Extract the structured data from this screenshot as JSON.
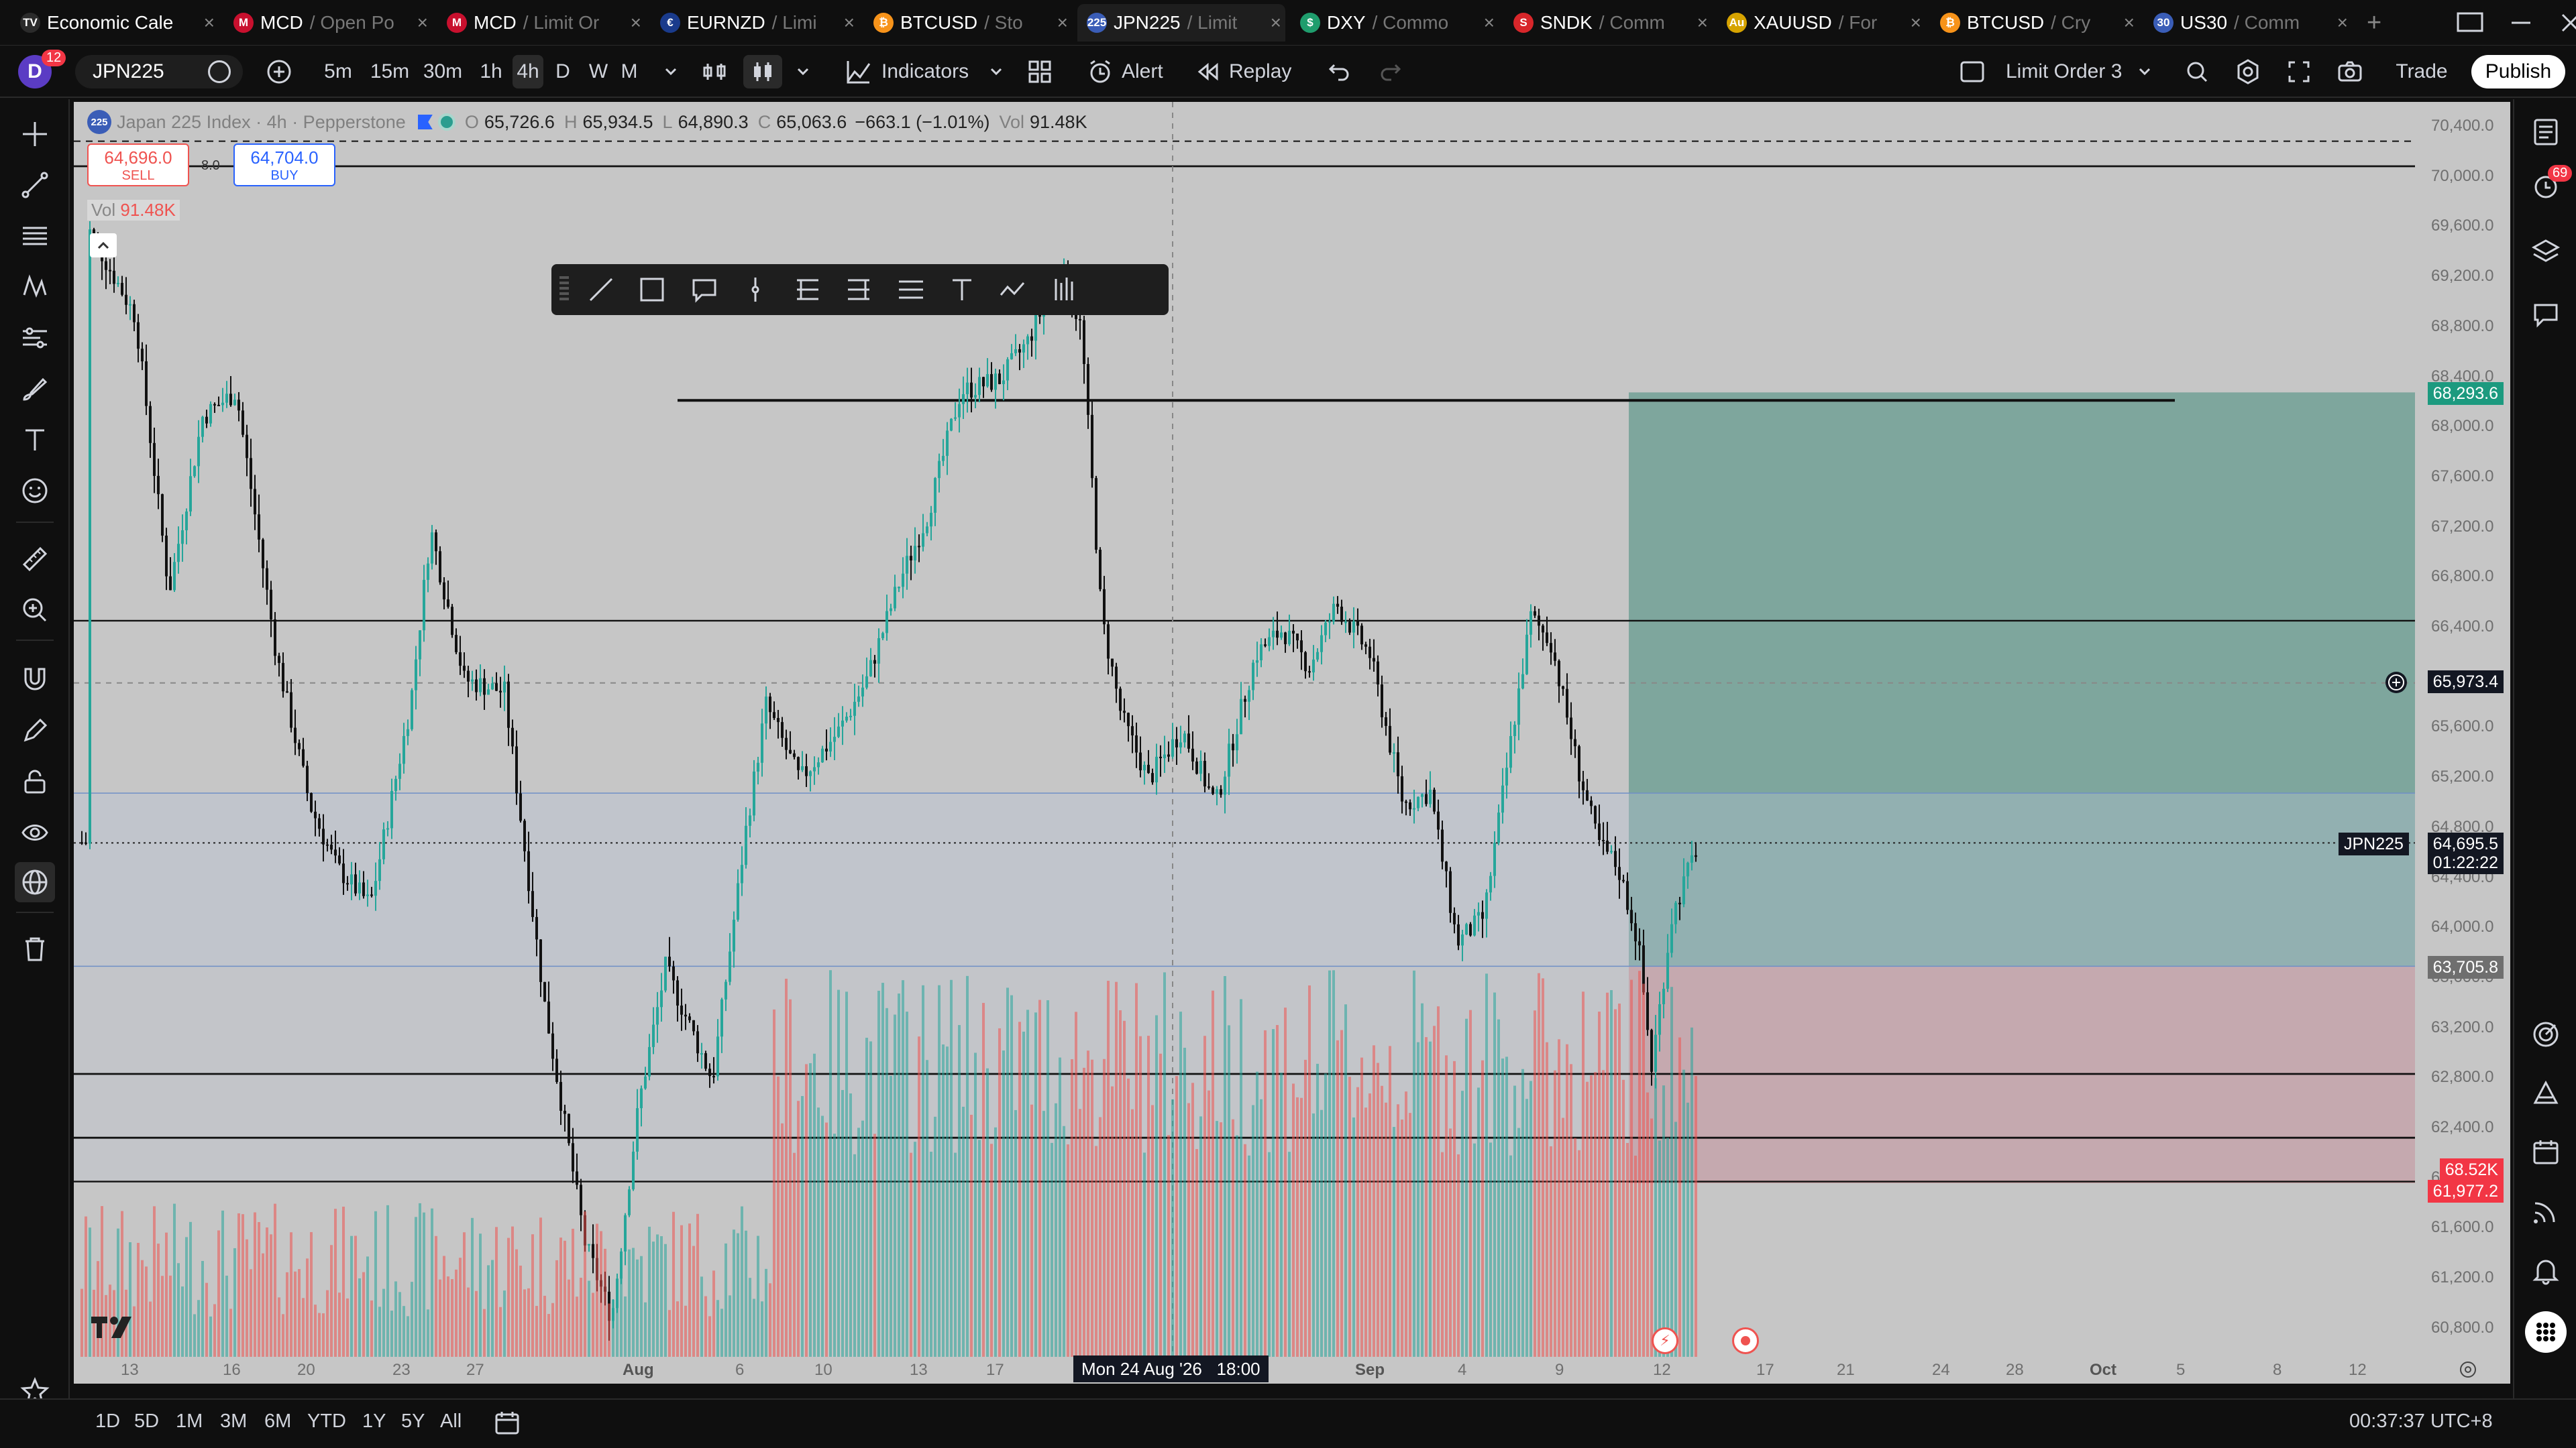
{
  "tabs": [
    {
      "sym": "Economic Cale",
      "rest": "",
      "icon": "tradingview-logo-icon",
      "iconColor": "#2b2b2b",
      "iconText": "TV"
    },
    {
      "sym": "MCD",
      "rest": " / Open Po",
      "icon": "mcdonalds-icon",
      "iconColor": "#c8102e",
      "iconText": "M"
    },
    {
      "sym": "MCD",
      "rest": " / Limit Or",
      "icon": "mcdonalds-icon",
      "iconColor": "#c8102e",
      "iconText": "M"
    },
    {
      "sym": "EURNZD",
      "rest": " / Limi",
      "icon": "eurnzd-flag-icon",
      "iconColor": "#1a3b8c",
      "iconText": "€"
    },
    {
      "sym": "BTCUSD",
      "rest": " / Sto",
      "icon": "bitcoin-icon",
      "iconColor": "#f7931a",
      "iconText": "₿"
    },
    {
      "sym": "JPN225",
      "rest": " / Limit",
      "icon": "jpn225-icon",
      "iconColor": "#3a5db7",
      "iconText": "225"
    },
    {
      "sym": "DXY",
      "rest": " / Commo",
      "icon": "dollar-icon",
      "iconColor": "#1f9d6d",
      "iconText": "$"
    },
    {
      "sym": "SNDK",
      "rest": " / Comm",
      "icon": "sandisk-icon",
      "iconColor": "#d8262a",
      "iconText": "S"
    },
    {
      "sym": "XAUUSD",
      "rest": " / For",
      "icon": "gold-icon",
      "iconColor": "#d6a300",
      "iconText": "Au"
    },
    {
      "sym": "BTCUSD",
      "rest": " / Cry",
      "icon": "bitcoin-icon",
      "iconColor": "#f7931a",
      "iconText": "₿"
    },
    {
      "sym": "US30",
      "rest": " / Comm",
      "icon": "us30-icon",
      "iconColor": "#3a5db7",
      "iconText": "30"
    }
  ],
  "notif_badge": "12",
  "right_badge": "69",
  "symbol": "JPN225",
  "intervals": [
    "5m",
    "15m",
    "30m",
    "1h",
    "4h",
    "D",
    "W",
    "M"
  ],
  "selected_interval": "4h",
  "indicators_label": "Indicators",
  "alert_label": "Alert",
  "replay_label": "Replay",
  "layout_name": "Limit Order 3",
  "trade_label": "Trade",
  "publish_label": "Publish",
  "legend": {
    "name": "Japan 225 Index · 4h · Pepperstone",
    "o_label": "O",
    "o": "65,726.6",
    "h_label": "H",
    "h": "65,934.5",
    "l_label": "L",
    "l": "64,890.3",
    "c_label": "C",
    "c": "65,063.6",
    "change": "−663.1 (−1.01%)",
    "v_label": "Vol",
    "v": "91.48K"
  },
  "sell_price": "64,696.0",
  "sell_label": "SELL",
  "spread": "8.0",
  "buy_price": "64,704.0",
  "buy_label": "BUY",
  "vol_row_label": "Vol",
  "vol_row_value": "91.48K",
  "price_axis": [
    "70,400.0",
    "70,000.0",
    "69,600.0",
    "69,200.0",
    "68,800.0",
    "68,400.0",
    "68,000.0",
    "67,600.0",
    "67,200.0",
    "66,800.0",
    "66,400.0",
    "66,000.0",
    "65,600.0",
    "65,200.0",
    "64,800.0",
    "64,400.0",
    "64,000.0",
    "63,600.0",
    "63,200.0",
    "62,800.0",
    "62,400.0",
    "62,000.0",
    "61,600.0",
    "61,200.0",
    "60,800.0"
  ],
  "price_labels": {
    "target": "68,293.6",
    "crosshair": "65,973.4",
    "symbol_tag": "JPN225",
    "current": "64,695.5",
    "countdown": "01:22:22",
    "entry": "63,705.8",
    "volume": "68.52K",
    "stop": "61,977.2"
  },
  "time_axis": [
    "13",
    "16",
    "20",
    "23",
    "27",
    "Aug",
    "6",
    "10",
    "13",
    "17",
    "Sep",
    "4",
    "9",
    "12",
    "17",
    "21",
    "24",
    "28",
    "Oct",
    "5",
    "8",
    "12"
  ],
  "crosshair_time": "Mon 24 Aug '26   18:00",
  "ranges": [
    "1D",
    "5D",
    "1M",
    "3M",
    "6M",
    "YTD",
    "1Y",
    "5Y",
    "All"
  ],
  "clock": "00:37:37 UTC+8",
  "colors": {
    "up": "#26a69a",
    "down": "#ef5350",
    "target_zone": "#7ea69d",
    "stop_zone": "#c9a3a6",
    "chart_bg": "#c6c6c6",
    "accent": "#2962ff"
  }
}
